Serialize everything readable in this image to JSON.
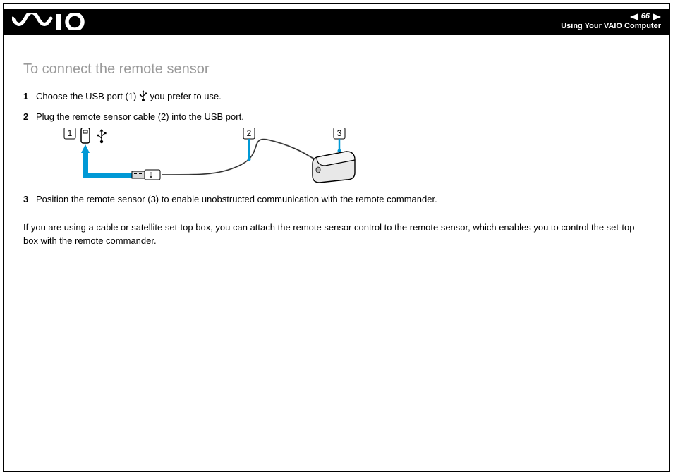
{
  "header": {
    "page_number": "66",
    "breadcrumb": "Using Your VAIO Computer"
  },
  "title": "To connect the remote sensor",
  "steps": [
    {
      "num": "1",
      "text_before": "Choose the USB port (1) ",
      "text_after": " you prefer to use."
    },
    {
      "num": "2",
      "text_before": "Plug the remote sensor cable (2) into the USB port.",
      "text_after": ""
    },
    {
      "num": "3",
      "text_before": "Position the remote sensor (3) to enable unobstructed communication with the remote commander.",
      "text_after": ""
    }
  ],
  "figure_labels": {
    "l1": "1",
    "l2": "2",
    "l3": "3"
  },
  "paragraph": "If you are using a cable or satellite set-top box, you can attach the remote sensor control to the remote sensor, which enables you to control the set-top box with the remote commander."
}
